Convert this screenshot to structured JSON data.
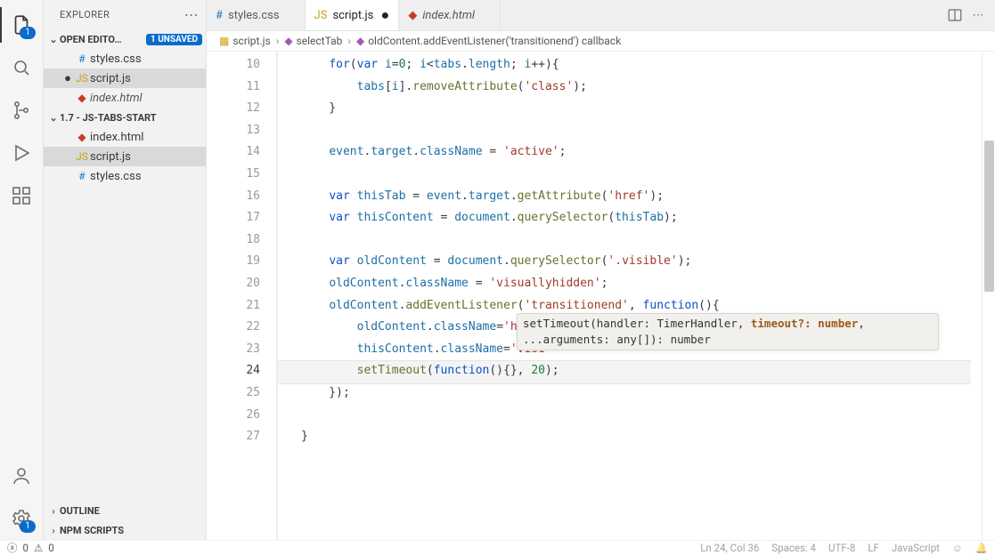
{
  "sidebar": {
    "title": "EXPLORER",
    "openEditorsLabel": "OPEN EDITO…",
    "unsavedBadge": "1 UNSAVED",
    "openEditors": [
      {
        "name": "styles.css",
        "iconClass": "ico-css",
        "dirty": false,
        "preview": false
      },
      {
        "name": "script.js",
        "iconClass": "ico-js",
        "dirty": true,
        "preview": false,
        "active": true
      },
      {
        "name": "index.html",
        "iconClass": "ico-html",
        "dirty": false,
        "preview": true
      }
    ],
    "folderName": "1.7 - JS-TABS-START",
    "folderItems": [
      {
        "name": "index.html",
        "iconClass": "ico-html"
      },
      {
        "name": "script.js",
        "iconClass": "ico-js",
        "active": true
      },
      {
        "name": "styles.css",
        "iconClass": "ico-css"
      }
    ],
    "outlineLabel": "OUTLINE",
    "npmLabel": "NPM SCRIPTS"
  },
  "activity": {
    "filesBadge": "1",
    "gearBadge": "1"
  },
  "tabs": [
    {
      "name": "styles.css",
      "iconClass": "ico-css",
      "active": false,
      "dirty": false,
      "preview": false
    },
    {
      "name": "script.js",
      "iconClass": "ico-js",
      "active": true,
      "dirty": true,
      "preview": false
    },
    {
      "name": "index.html",
      "iconClass": "ico-html",
      "active": false,
      "dirty": false,
      "preview": true
    }
  ],
  "breadcrumb": {
    "file": "script.js",
    "sym1": "selectTab",
    "sym2": "oldContent.addEventListener('transitionend') callback"
  },
  "code": {
    "startLine": 10,
    "currentLine": 24,
    "lines": [
      {
        "n": 10,
        "html": "    <span class='k-kw'>for</span>(<span class='k-kw'>var</span> <span class='k-id'>i</span>=<span class='k-num'>0</span>; <span class='k-id'>i</span>&lt;<span class='k-id'>tabs</span>.<span class='k-prop'>length</span>; <span class='k-id'>i</span>++){"
      },
      {
        "n": 11,
        "html": "        <span class='k-id'>tabs</span>[<span class='k-id'>i</span>].<span class='k-mth'>removeAttribute</span>(<span class='k-str'>'class'</span>);"
      },
      {
        "n": 12,
        "html": "    }"
      },
      {
        "n": 13,
        "html": ""
      },
      {
        "n": 14,
        "html": "    <span class='k-id'>event</span>.<span class='k-prop'>target</span>.<span class='k-prop'>className</span> = <span class='k-str'>'active'</span>;"
      },
      {
        "n": 15,
        "html": ""
      },
      {
        "n": 16,
        "html": "    <span class='k-kw'>var</span> <span class='k-id'>thisTab</span> = <span class='k-id'>event</span>.<span class='k-prop'>target</span>.<span class='k-mth'>getAttribute</span>(<span class='k-str'>'href'</span>);"
      },
      {
        "n": 17,
        "html": "    <span class='k-kw'>var</span> <span class='k-id'>thisContent</span> = <span class='k-id'>document</span>.<span class='k-mth'>querySelector</span>(<span class='k-id'>thisTab</span>);"
      },
      {
        "n": 18,
        "html": ""
      },
      {
        "n": 19,
        "html": "    <span class='k-kw'>var</span> <span class='k-id'>oldContent</span> = <span class='k-id'>document</span>.<span class='k-mth'>querySelector</span>(<span class='k-str'>'.visible'</span>);"
      },
      {
        "n": 20,
        "html": "    <span class='k-id'>oldContent</span>.<span class='k-prop'>className</span> = <span class='k-str'>'visuallyhidden'</span>;"
      },
      {
        "n": 21,
        "html": "    <span class='k-id'>oldContent</span>.<span class='k-mth'>addEventListener</span>(<span class='k-str'>'transitionend'</span>, <span class='k-kw'>function</span>(){"
      },
      {
        "n": 22,
        "html": "        <span class='k-id'>oldContent</span>.<span class='k-prop'>className</span>=<span class='k-str'>'hidde</span>"
      },
      {
        "n": 23,
        "html": "        <span class='k-id'>thisContent</span>.<span class='k-prop'>className</span>=<span class='k-str'>'visi</span>"
      },
      {
        "n": 24,
        "html": "        <span class='k-mth'>setTimeout</span>(<span class='k-kw'>function</span>(){}, <span class='k-num'>20</span>);"
      },
      {
        "n": 25,
        "html": "    });"
      },
      {
        "n": 26,
        "html": ""
      },
      {
        "n": 27,
        "html": "}"
      }
    ]
  },
  "signatureHelp": {
    "line1_pre": "setTimeout(handler: TimerHandler, ",
    "line1_act": "timeout?: number",
    "line1_post": ",",
    "line2": "...arguments: any[]): number"
  },
  "status": {
    "errors": "0",
    "warnings": "0",
    "pos": "Ln 24, Col 36",
    "spaces": "Spaces: 4",
    "enc": "UTF-8",
    "eol": "LF",
    "lang": "JavaScript"
  }
}
